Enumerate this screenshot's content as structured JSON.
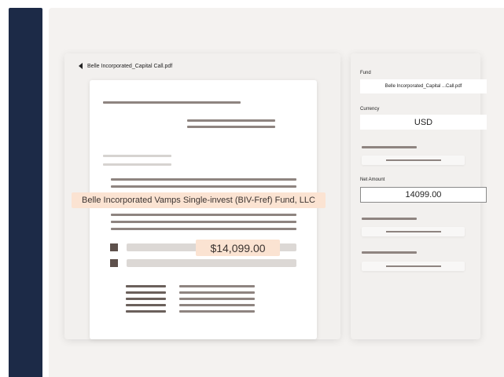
{
  "document": {
    "file_name": "Belle Incorporated_Capital Call.pdf",
    "fund_highlight": "Belle Incorporated Vamps Single-invest (BIV-Fref) Fund, LLC",
    "amount_highlight": "$14,099.00"
  },
  "form": {
    "fund_label": "Fund",
    "fund_value": "Belle Incorporated_Capital ...Call.pdf",
    "currency_label": "Currency",
    "currency_value": "USD",
    "net_amount_label": "Net Amount",
    "net_amount_value": "14099.00"
  },
  "colors": {
    "nav": "#1c2a47",
    "highlight": "#fbe3d2",
    "placeholder_bar": "#8e8480"
  }
}
